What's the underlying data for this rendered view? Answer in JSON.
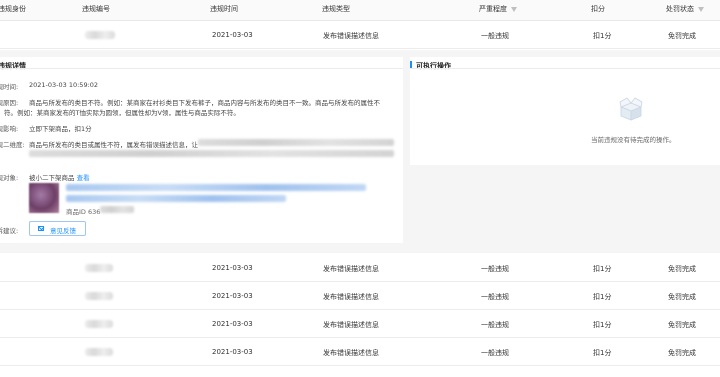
{
  "table": {
    "headers": [
      "违规身份",
      "违规编号",
      "违规时间",
      "违规类型",
      "严重程度",
      "扣分",
      "处罚状态"
    ],
    "rows": [
      {
        "time": "2021-03-03",
        "type": "发布错误描述信息",
        "level": "一般违规",
        "score": "扣1分",
        "status": "免罚完成"
      },
      {
        "time": "2021-03-03",
        "type": "发布错误描述信息",
        "level": "一般违规",
        "score": "扣1分",
        "status": "免罚完成"
      },
      {
        "time": "2021-03-03",
        "type": "发布错误描述信息",
        "level": "一般违规",
        "score": "扣1分",
        "status": "免罚完成"
      },
      {
        "time": "2021-03-03",
        "type": "发布错误描述信息",
        "level": "一般违规",
        "score": "扣1分",
        "status": "免罚完成"
      },
      {
        "time": "2021-03-03",
        "type": "发布错误描述信息",
        "level": "一般违规",
        "score": "扣1分",
        "status": "免罚完成"
      }
    ]
  },
  "detail": {
    "title": "违规详情",
    "time_label": "违规时间:",
    "time_value": "2021-03-03 10:59:02",
    "reason_label": "违规原因:",
    "reason_line1": "商品与所发布的类目不符。例如：某商家在衬衫类目下发布裤子，商品内容与所发布的类目不一致。商品与所发布的属性不",
    "reason_line2": "符。例如：某商家发布的T恤实际为圆领，但属性却为V领，属性与商品实际不符。",
    "impact_label": "违规影响:",
    "impact_value": "立即下架商品，扣1分",
    "desc_label": "违规二维度:",
    "desc_value": "商品与所发布的类目或属性不符，属发布错误描述信息，让",
    "object_label": "违规对象:",
    "object_text": "被小二下架商品",
    "object_link": "查看",
    "product_id_label": "商品ID 636",
    "suggest_label": "申诉建议:",
    "feedback_button": "意见反馈"
  },
  "actions": {
    "title": "可执行操作",
    "empty_text": "当前违规没有待完成的操作。"
  }
}
